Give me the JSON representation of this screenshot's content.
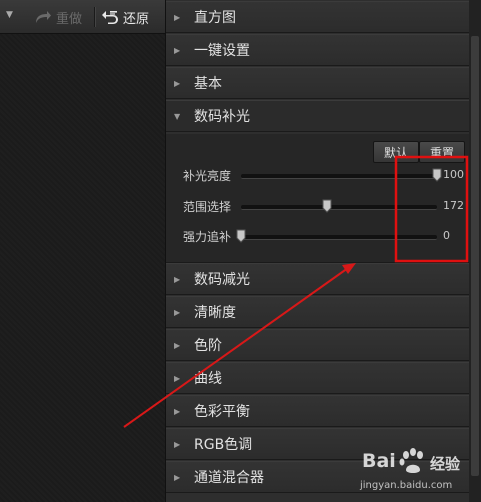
{
  "toolbar": {
    "redo_label": "重做",
    "undo_label": "还原"
  },
  "sections": [
    {
      "title": "直方图",
      "expanded": false
    },
    {
      "title": "一键设置",
      "expanded": false
    },
    {
      "title": "基本",
      "expanded": false
    },
    {
      "title": "数码补光",
      "expanded": true
    },
    {
      "title": "数码减光",
      "expanded": false
    },
    {
      "title": "清晰度",
      "expanded": false
    },
    {
      "title": "色阶",
      "expanded": false
    },
    {
      "title": "曲线",
      "expanded": false
    },
    {
      "title": "色彩平衡",
      "expanded": false
    },
    {
      "title": "RGB色调",
      "expanded": false
    },
    {
      "title": "通道混合器",
      "expanded": false
    }
  ],
  "fill_light": {
    "default_label": "默认",
    "reset_label": "重置",
    "sliders": [
      {
        "label": "补光亮度",
        "value": "100",
        "level": 1.0
      },
      {
        "label": "范围选择",
        "value": "172",
        "level": 0.44
      },
      {
        "label": "强力追补",
        "value": "0",
        "level": 0.0
      }
    ]
  },
  "annotation": {
    "highlight_color": "#e01010",
    "arrow_color": "#d81818"
  },
  "watermark": {
    "brand": "Bai",
    "product": "经验",
    "url": "jingyan.baidu.com"
  }
}
